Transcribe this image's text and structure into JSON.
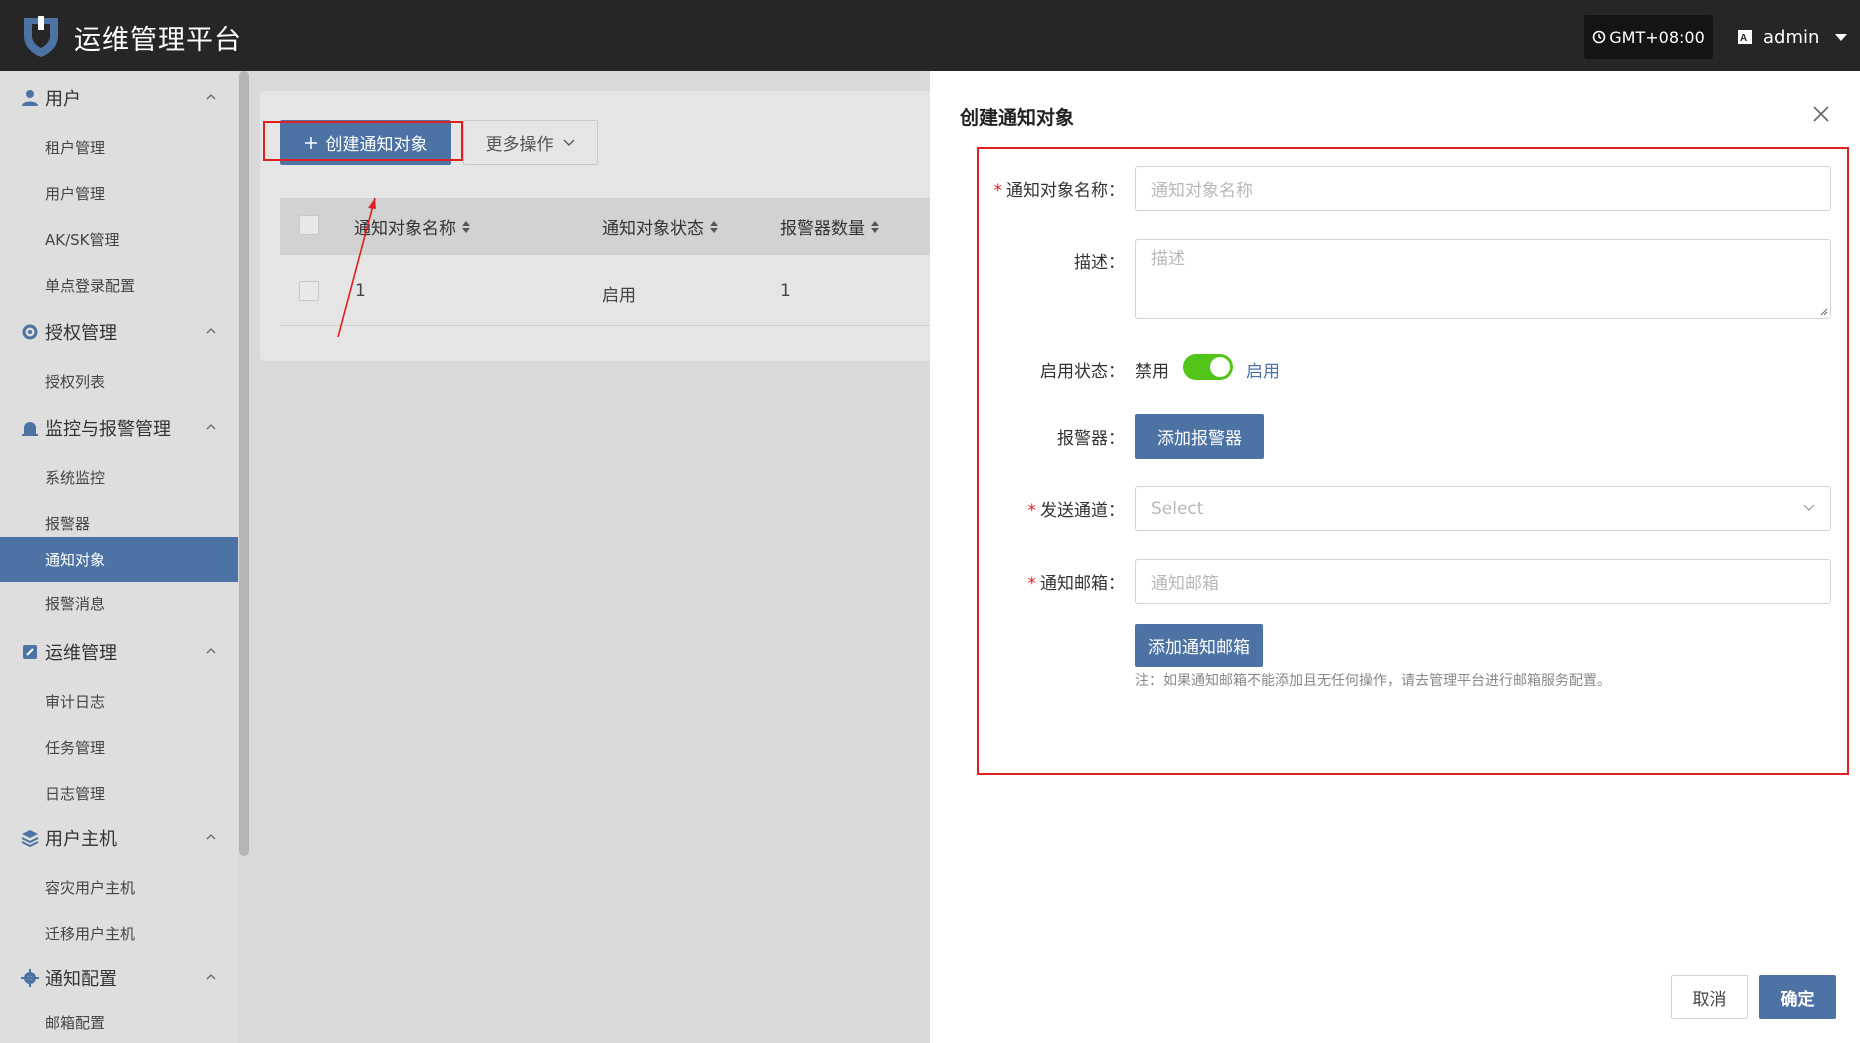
{
  "header": {
    "app_title": "运维管理平台",
    "timezone": "GMT+08:00",
    "user": "admin"
  },
  "sidebar": {
    "groups": [
      {
        "label": "用户",
        "icon": "user-icon",
        "items": [
          "租户管理",
          "用户管理",
          "AK/SK管理",
          "单点登录配置"
        ]
      },
      {
        "label": "授权管理",
        "icon": "gear-shield-icon",
        "items": [
          "授权列表"
        ]
      },
      {
        "label": "监控与报警管理",
        "icon": "alarm-icon",
        "items": [
          "系统监控",
          "报警器",
          "通知对象",
          "报警消息"
        ]
      },
      {
        "label": "运维管理",
        "icon": "wrench-icon",
        "items": [
          "审计日志",
          "任务管理",
          "日志管理"
        ]
      },
      {
        "label": "用户主机",
        "icon": "layers-icon",
        "items": [
          "容灾用户主机",
          "迁移用户主机"
        ]
      },
      {
        "label": "通知配置",
        "icon": "gear-icon",
        "items": [
          "邮箱配置"
        ]
      }
    ],
    "active_item": "通知对象"
  },
  "list": {
    "create_button": "创建通知对象",
    "more_button": "更多操作",
    "columns": [
      "通知对象名称",
      "通知对象状态",
      "报警器数量"
    ],
    "rows": [
      {
        "name": "1",
        "status": "启用",
        "alarm_count": "1"
      }
    ]
  },
  "drawer": {
    "title": "创建通知对象",
    "fields": {
      "name_label": "通知对象名称：",
      "name_placeholder": "通知对象名称",
      "desc_label": "描述：",
      "desc_placeholder": "描述",
      "status_label": "启用状态：",
      "status_off": "禁用",
      "status_on": "启用",
      "status_enabled": true,
      "alarm_label": "报警器：",
      "alarm_button": "添加报警器",
      "channel_label": "发送通道：",
      "channel_placeholder": "Select",
      "email_label": "通知邮箱：",
      "email_placeholder": "通知邮箱",
      "add_email_button": "添加通知邮箱",
      "note": "注：如果通知邮箱不能添加且无任何操作，请去管理平台进行邮箱服务配置。"
    },
    "cancel_button": "取消",
    "ok_button": "确定"
  },
  "colors": {
    "primary": "#4d73a5",
    "topbar": "#262626",
    "toggle_on": "#52c41a",
    "required": "#e02020",
    "annotation": "#e02020"
  }
}
